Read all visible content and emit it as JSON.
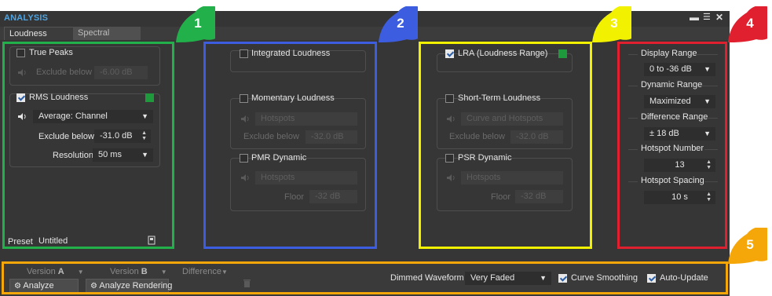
{
  "window": {
    "title": "ANALYSIS",
    "minimize_icon": "minus-icon",
    "menu_icon": "menu-icon",
    "close_label": "✕"
  },
  "tabs": [
    {
      "label": "Loudness Profile",
      "active": true
    },
    {
      "label": "Spectral Profile",
      "active": false
    }
  ],
  "group1": {
    "true_peaks": {
      "label": "True Peaks",
      "checked": false,
      "exclude_label": "Exclude below",
      "exclude_value": "-6.00 dB"
    },
    "rms": {
      "label": "RMS Loudness",
      "checked": true,
      "mode": "Average: Channel",
      "exclude_label": "Exclude below",
      "exclude_value": "-31.0 dB",
      "resolution_label": "Resolution",
      "resolution_value": "50 ms"
    },
    "preset_label": "Preset",
    "preset_value": "Untitled"
  },
  "group2": {
    "integrated": {
      "label": "Integrated Loudness",
      "checked": false
    },
    "momentary": {
      "label": "Momentary Loudness",
      "checked": false,
      "mode": "Hotspots",
      "exclude_label": "Exclude below",
      "exclude_value": "-32.0 dB"
    },
    "pmr": {
      "label": "PMR Dynamic",
      "checked": false,
      "mode": "Hotspots",
      "floor_label": "Floor",
      "floor_value": "-32 dB"
    }
  },
  "group3": {
    "lra": {
      "label": "LRA (Loudness Range)",
      "checked": true
    },
    "short_term": {
      "label": "Short-Term Loudness",
      "checked": false,
      "mode": "Curve and Hotspots",
      "exclude_label": "Exclude below",
      "exclude_value": "-32.0 dB"
    },
    "psr": {
      "label": "PSR Dynamic",
      "checked": false,
      "mode": "Hotspots",
      "floor_label": "Floor",
      "floor_value": "-32 dB"
    }
  },
  "group4": {
    "display_range": {
      "label": "Display Range",
      "value": "0 to -36 dB"
    },
    "dynamic_range": {
      "label": "Dynamic Range",
      "value": "Maximized"
    },
    "difference_range": {
      "label": "Difference Range",
      "value": "± 18 dB"
    },
    "hotspot_number": {
      "label": "Hotspot Number",
      "value": "13"
    },
    "hotspot_spacing": {
      "label": "Hotspot Spacing",
      "value": "10 s"
    }
  },
  "bottom": {
    "version_a_prefix": "Version",
    "version_a": "A",
    "version_b_prefix": "Version",
    "version_b": "B",
    "difference": "Difference",
    "analyze": "Analyze",
    "analyze_rendering": "Analyze Rendering",
    "dimmed_waveform_label": "Dimmed Waveform",
    "dimmed_waveform_value": "Very Faded",
    "curve_smoothing": "Curve Smoothing",
    "auto_update": "Auto-Update"
  },
  "badges": [
    "1",
    "2",
    "3",
    "4",
    "5"
  ],
  "colors": {
    "green": "#22b04b",
    "blue": "#3d5de0",
    "yellow": "#f2f200",
    "red": "#e0202e",
    "orange": "#f5a70a"
  }
}
